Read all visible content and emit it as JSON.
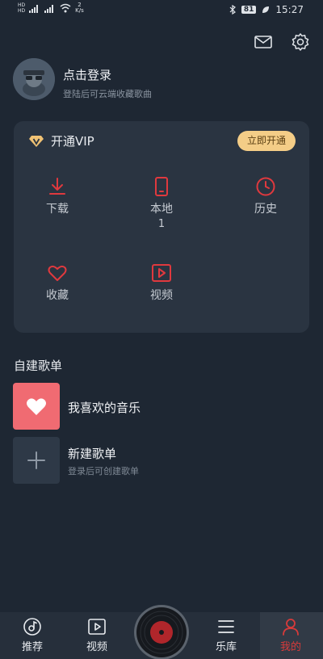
{
  "status_bar": {
    "left_hd1": "HD",
    "left_hd2": "HD",
    "net_rate": "2",
    "net_unit": "K/s",
    "battery": "81",
    "time": "15:27"
  },
  "login": {
    "title": "点击登录",
    "subtitle": "登陆后可云端收藏歌曲"
  },
  "vip": {
    "label": "开通VIP",
    "button": "立即开通"
  },
  "grid": {
    "download": {
      "label": "下载"
    },
    "local": {
      "label": "本地",
      "count": "1"
    },
    "history": {
      "label": "历史"
    },
    "favorites": {
      "label": "收藏"
    },
    "video": {
      "label": "视频"
    }
  },
  "playlists": {
    "section_title": "自建歌单",
    "liked": {
      "title": "我喜欢的音乐"
    },
    "new": {
      "title": "新建歌单",
      "subtitle": "登录后可创建歌单"
    }
  },
  "bottom_nav": {
    "recommend": "推荐",
    "video": "视频",
    "library": "乐库",
    "mine": "我的"
  },
  "colors": {
    "accent": "#d83a3a",
    "background": "#1e2733",
    "card": "#2a3441",
    "vip_button": "#f4cd87",
    "liked_cover": "#f06b72"
  }
}
